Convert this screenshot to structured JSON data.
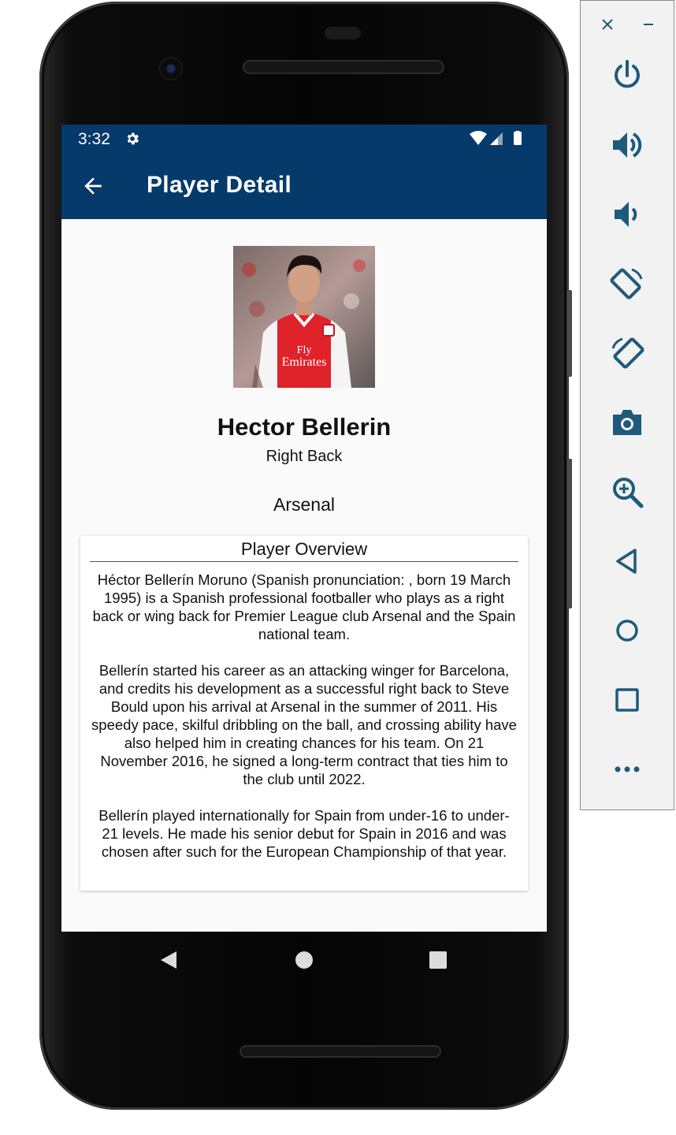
{
  "status_bar": {
    "time": "3:32"
  },
  "app_bar": {
    "title": "Player Detail"
  },
  "player": {
    "name": "Hector Bellerin",
    "position": "Right Back",
    "club": "Arsenal",
    "shirt_sponsor_line1": "Fly",
    "shirt_sponsor_line2": "Emirates"
  },
  "overview": {
    "title": "Player Overview",
    "paragraphs": [
      "Héctor Bellerín Moruno (Spanish pronunciation: , born 19 March 1995) is a Spanish professional footballer who plays as a right back or wing back for Premier League club Arsenal and the Spain national team.",
      "Bellerín started his career as an attacking winger for Barcelona, and credits his development as a successful right back to Steve Bould upon his arrival at Arsenal in the summer of 2011. His speedy pace, skilful dribbling on the ball, and crossing ability have also helped him in creating chances for his team. On 21 November 2016, he signed a long-term contract that ties him to the club until 2022.",
      "Bellerín played internationally for Spain from under-16 to under-21 levels. He made his senior debut for Spain in 2016 and was chosen after such for the European Championship of that year."
    ]
  },
  "colors": {
    "app_bar": "#063a6a",
    "screen_bg": "#fafafa",
    "panel_icon": "#1e5a7a"
  },
  "icons": {
    "status": [
      "gear-icon",
      "wifi-icon",
      "signal-icon",
      "battery-icon"
    ],
    "navigation": [
      "back-triangle-icon",
      "home-circle-icon",
      "recents-square-icon"
    ],
    "emulator_panel": [
      "close-icon",
      "minimize-icon",
      "power-icon",
      "volume-up-icon",
      "volume-down-icon",
      "rotate-left-icon",
      "rotate-right-icon",
      "camera-icon",
      "zoom-icon",
      "back-icon",
      "home-icon",
      "overview-icon",
      "more-icon"
    ]
  }
}
